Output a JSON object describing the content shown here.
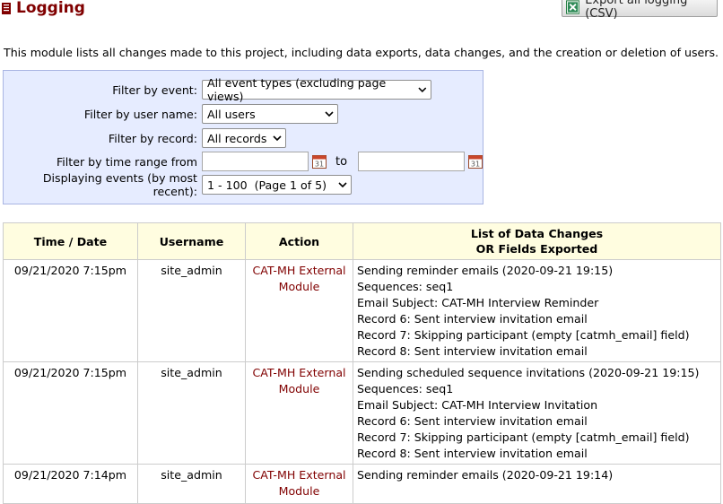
{
  "header": {
    "title": "Logging",
    "export_label": "Export all logging (CSV)"
  },
  "intro": "This module lists all changes made to this project, including data exports, data changes, and the creation or deletion of users.",
  "filters": {
    "event_label": "Filter by event:",
    "event_value": "All event types (excluding page views)",
    "user_label": "Filter by user name:",
    "user_value": "All users",
    "record_label": "Filter by record:",
    "record_value": "All records",
    "time_label": "Filter by time range from",
    "time_to": "to",
    "display_label": "Displaying events (by most recent):",
    "display_value": "1 - 100  (Page 1 of 5)"
  },
  "table": {
    "col_time": "Time / Date",
    "col_user": "Username",
    "col_action": "Action",
    "col_changes_1": "List of Data Changes",
    "col_changes_2": "OR Fields Exported",
    "rows": [
      {
        "time": "09/21/2020 7:15pm",
        "user": "site_admin",
        "action": "CAT-MH External Module",
        "changes": [
          "Sending reminder emails (2020-09-21 19:15)",
          "Sequences: seq1",
          "Email Subject: CAT-MH Interview Reminder",
          "Record 6: Sent interview invitation email",
          "Record 7: Skipping participant (empty [catmh_email] field)",
          "Record 8: Sent interview invitation email"
        ]
      },
      {
        "time": "09/21/2020 7:15pm",
        "user": "site_admin",
        "action": "CAT-MH External Module",
        "changes": [
          "Sending scheduled sequence invitations (2020-09-21 19:15)",
          "Sequences: seq1",
          "Email Subject: CAT-MH Interview Invitation",
          "Record 6: Sent interview invitation email",
          "Record 7: Skipping participant (empty [catmh_email] field)",
          "Record 8: Sent interview invitation email"
        ]
      },
      {
        "time": "09/21/2020 7:14pm",
        "user": "site_admin",
        "action": "CAT-MH External Module",
        "changes": [
          "Sending reminder emails (2020-09-21 19:14)"
        ]
      }
    ]
  },
  "colors": {
    "title": "#800000",
    "filter_bg": "#e6ecff",
    "header_bg": "#fffde0"
  }
}
